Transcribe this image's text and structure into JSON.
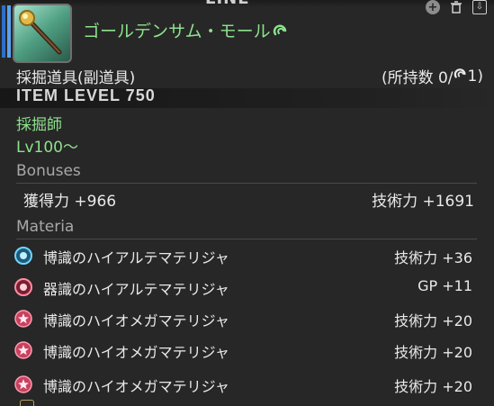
{
  "window": {
    "top_title": "LINE"
  },
  "header": {
    "item_name": "ゴールデンサム・モール",
    "quality_icon": "hq-icon",
    "icon": "pickaxe-icon"
  },
  "category": {
    "label": "採掘道具(副道具)",
    "owned_prefix": "(所持数 0/",
    "owned_suffix": " 1)"
  },
  "item_level": "ITEM LEVEL 750",
  "job": "採掘師",
  "level_req": "Lv100～",
  "bonuses": {
    "header": "Bonuses",
    "left": "獲得力 +966",
    "right": "技術力 +1691"
  },
  "materia": {
    "header": "Materia",
    "items": [
      {
        "name": "博識のハイアルテマテリジャ",
        "value": "技術力 +36",
        "color": "#4fb9e6",
        "icon": "materia-blue-icon"
      },
      {
        "name": "器識のハイアルテマテリジャ",
        "value": "GP +11",
        "color": "#e06b7a",
        "icon": "materia-red-icon"
      },
      {
        "name": "博識のハイオメガマテリジャ",
        "value": "技術力 +20",
        "color": "#e85d7a",
        "icon": "materia-star-icon"
      },
      {
        "name": "博識のハイオメガマテリジャ",
        "value": "技術力 +20",
        "color": "#e85d7a",
        "icon": "materia-star-icon"
      },
      {
        "name": "博識のハイオメガマテリジャ",
        "value": "技術力 +20",
        "color": "#e85d7a",
        "icon": "materia-star-icon"
      }
    ]
  },
  "colors": {
    "accent_green": "#8de28d",
    "bar_blue": "#2f6fc9"
  }
}
